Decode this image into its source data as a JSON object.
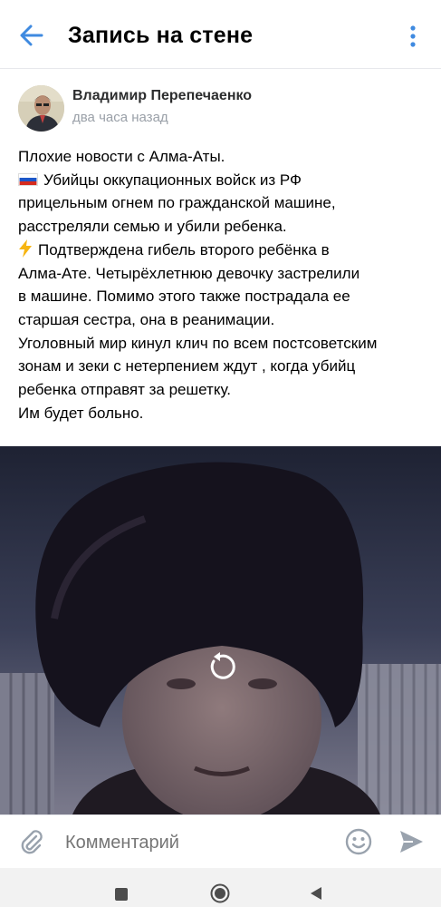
{
  "header": {
    "title": "Запись на стене",
    "back_icon": "arrow-left-icon",
    "more_icon": "more-vertical-icon"
  },
  "post": {
    "author": "Владимир Перепечаенко",
    "time": "два часа назад",
    "lines": [
      "Плохие новости с Алма-Аты.",
      "Убийцы оккупационных войск из РФ",
      "прицельным огнем по гражданской машине,",
      "расстреляли семью и убили ребенка.",
      "Подтверждена гибель второго ребёнка в",
      "Алма-Ате. Четырёхлетнюю девочку застрелили",
      "в машине. Помимо этого также пострадала ее",
      "старшая сестра, она в реанимации.",
      "Уголовный мир кинул клич по всем постсоветским",
      "зонам и зеки с нетерпением ждут , когда убийц",
      "ребенка отправят за решетку.",
      "Им будет больно."
    ]
  },
  "video": {
    "replay_icon": "replay-icon"
  },
  "comment": {
    "placeholder": "Комментарий",
    "attach_icon": "paperclip-icon",
    "emoji_icon": "smile-icon",
    "send_icon": "send-icon"
  },
  "colors": {
    "accent": "#3f8ae0",
    "icon_gray": "#818c99",
    "secondary_text": "#9aa0a8"
  }
}
